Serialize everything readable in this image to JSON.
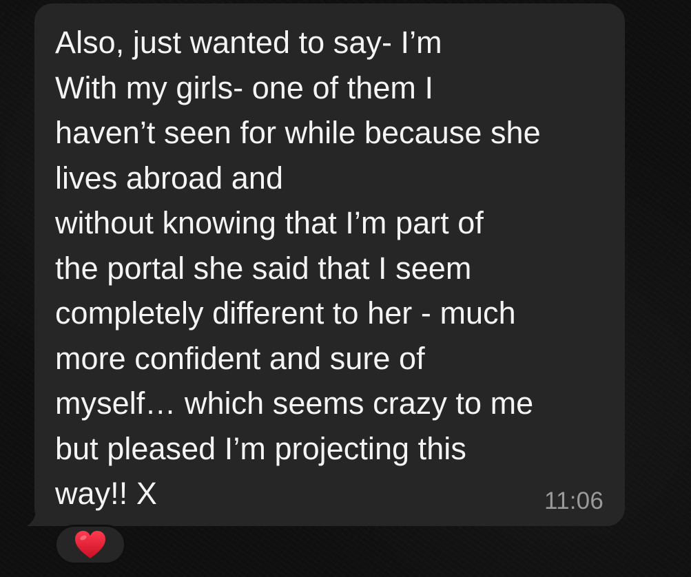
{
  "message": {
    "text": "Also, just wanted to say- I’m\nWith my girls- one of them I\nhaven’t seen for while because she\nlives abroad and\nwithout knowing that I’m part of\nthe portal she said that I seem\ncompletely different to her - much\nmore confident and sure of\nmyself… which seems crazy to me\nbut pleased I’m projecting this\nway!! X",
    "timestamp": "11:06"
  },
  "reaction": {
    "icon": "red-heart-icon",
    "color": "#e5233a"
  },
  "colors": {
    "background": "#0f0f0f",
    "bubble": "#262626",
    "text": "#f4f4f4",
    "timestamp": "#9a9a9a"
  }
}
